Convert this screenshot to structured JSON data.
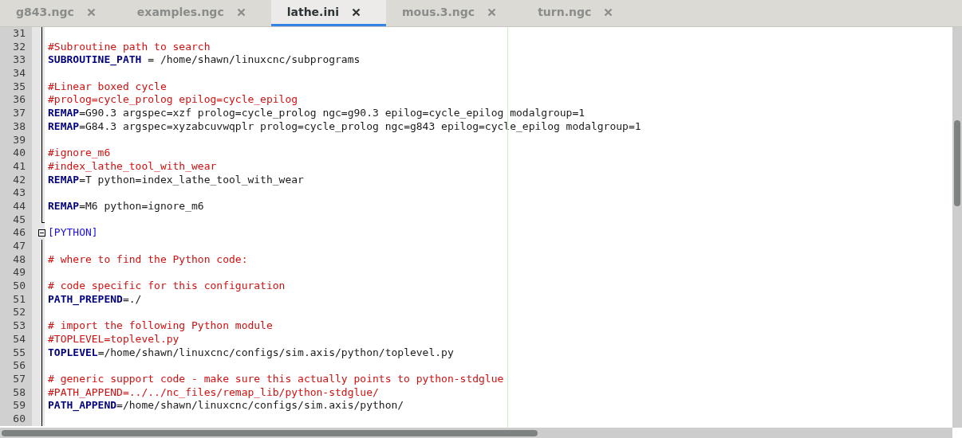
{
  "tabs": [
    {
      "label": "g843.ngc",
      "selected": false
    },
    {
      "label": "examples.ngc",
      "selected": false
    },
    {
      "label": "lathe.ini",
      "selected": true
    },
    {
      "label": "mous.3.ngc",
      "selected": false
    },
    {
      "label": "turn.ngc",
      "selected": false
    }
  ],
  "editor": {
    "lines": [
      {
        "number": "31",
        "kind": "body"
      },
      {
        "number": "32",
        "kind": "body",
        "segments": [
          {
            "kind": "comment",
            "text": "#Subroutine path to search"
          }
        ]
      },
      {
        "number": "33",
        "kind": "body",
        "segments": [
          {
            "kind": "key",
            "text": "SUBROUTINE_PATH"
          },
          {
            "kind": "plain",
            "text": " = /home/shawn/linuxcnc/subprograms"
          }
        ]
      },
      {
        "number": "34",
        "kind": "body"
      },
      {
        "number": "35",
        "kind": "body",
        "segments": [
          {
            "kind": "comment",
            "text": "#Linear boxed cycle"
          }
        ]
      },
      {
        "number": "36",
        "kind": "body",
        "segments": [
          {
            "kind": "comment",
            "text": "#prolog=cycle_prolog epilog=cycle_epilog"
          }
        ]
      },
      {
        "number": "37",
        "kind": "body",
        "segments": [
          {
            "kind": "key",
            "text": "REMAP"
          },
          {
            "kind": "plain",
            "text": "=G90.3 argspec=xzf prolog=cycle_prolog ngc=g90.3 epilog=cycle_epilog modalgroup=1"
          }
        ]
      },
      {
        "number": "38",
        "kind": "body",
        "segments": [
          {
            "kind": "key",
            "text": "REMAP"
          },
          {
            "kind": "plain",
            "text": "=G84.3 argspec=xyzabcuvwqplr prolog=cycle_prolog ngc=g843 epilog=cycle_epilog modalgroup=1"
          }
        ]
      },
      {
        "number": "39",
        "kind": "body"
      },
      {
        "number": "40",
        "kind": "body",
        "segments": [
          {
            "kind": "comment",
            "text": "#ignore_m6"
          }
        ]
      },
      {
        "number": "41",
        "kind": "body",
        "segments": [
          {
            "kind": "comment",
            "text": "#index_lathe_tool_with_wear"
          }
        ]
      },
      {
        "number": "42",
        "kind": "body",
        "segments": [
          {
            "kind": "key",
            "text": "REMAP"
          },
          {
            "kind": "plain",
            "text": "=T python=index_lathe_tool_with_wear"
          }
        ]
      },
      {
        "number": "43",
        "kind": "body"
      },
      {
        "number": "44",
        "kind": "body",
        "segments": [
          {
            "kind": "key",
            "text": "REMAP"
          },
          {
            "kind": "plain",
            "text": "=M6 python=ignore_m6"
          }
        ]
      },
      {
        "number": "45",
        "kind": "end"
      },
      {
        "number": "46",
        "kind": "header",
        "expanded": true,
        "segments": [
          {
            "kind": "section",
            "text": "[PYTHON]"
          }
        ]
      },
      {
        "number": "47",
        "kind": "body"
      },
      {
        "number": "48",
        "kind": "body",
        "segments": [
          {
            "kind": "comment",
            "text": "# where to find the Python code:"
          }
        ]
      },
      {
        "number": "49",
        "kind": "body"
      },
      {
        "number": "50",
        "kind": "body",
        "segments": [
          {
            "kind": "comment",
            "text": "# code specific for this configuration"
          }
        ]
      },
      {
        "number": "51",
        "kind": "body",
        "segments": [
          {
            "kind": "key",
            "text": "PATH_PREPEND"
          },
          {
            "kind": "plain",
            "text": "=./"
          }
        ]
      },
      {
        "number": "52",
        "kind": "body"
      },
      {
        "number": "53",
        "kind": "body",
        "segments": [
          {
            "kind": "comment",
            "text": "# import the following Python module"
          }
        ]
      },
      {
        "number": "54",
        "kind": "body",
        "segments": [
          {
            "kind": "comment",
            "text": "#TOPLEVEL=toplevel.py"
          }
        ]
      },
      {
        "number": "55",
        "kind": "body",
        "segments": [
          {
            "kind": "key",
            "text": "TOPLEVEL"
          },
          {
            "kind": "plain",
            "text": "=/home/shawn/linuxcnc/configs/sim.axis/python/toplevel.py"
          }
        ]
      },
      {
        "number": "56",
        "kind": "body"
      },
      {
        "number": "57",
        "kind": "body",
        "segments": [
          {
            "kind": "comment",
            "text": "# generic support code - make sure this actually points to python-stdglue"
          }
        ]
      },
      {
        "number": "58",
        "kind": "body",
        "segments": [
          {
            "kind": "comment",
            "text": "#PATH_APPEND=../../nc_files/remap_lib/python-stdglue/"
          }
        ]
      },
      {
        "number": "59",
        "kind": "body",
        "segments": [
          {
            "kind": "key",
            "text": "PATH_APPEND"
          },
          {
            "kind": "plain",
            "text": "=/home/shawn/linuxcnc/configs/sim.axis/python/"
          }
        ]
      },
      {
        "number": "60",
        "kind": "body"
      }
    ]
  }
}
